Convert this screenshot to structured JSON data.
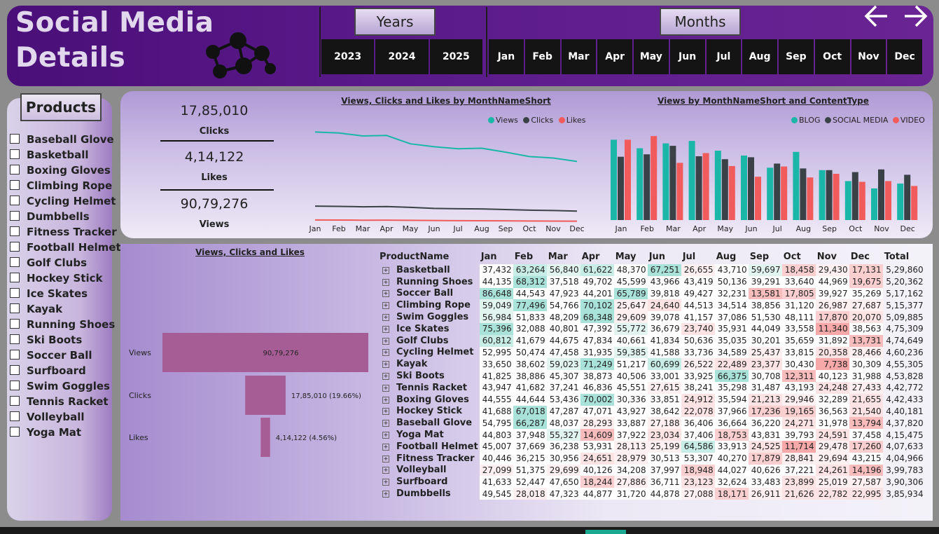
{
  "header": {
    "title": "Social Media Details",
    "years_label": "Years",
    "months_label": "Months"
  },
  "years": [
    "2023",
    "2024",
    "2025"
  ],
  "months": [
    "Jan",
    "Feb",
    "Mar",
    "Apr",
    "May",
    "Jun",
    "Jul",
    "Aug",
    "Sep",
    "Oct",
    "Nov",
    "Dec"
  ],
  "products_label": "Products",
  "products": [
    "Baseball Glove",
    "Basketball",
    "Boxing Gloves",
    "Climbing Rope",
    "Cycling Helmet",
    "Dumbbells",
    "Fitness Tracker",
    "Football Helmet",
    "Golf Clubs",
    "Hockey Stick",
    "Ice Skates",
    "Kayak",
    "Running Shoes",
    "Ski Boots",
    "Soccer Ball",
    "Surfboard",
    "Swim Goggles",
    "Tennis Racket",
    "Volleyball",
    "Yoga Mat"
  ],
  "kpis": [
    {
      "value": "17,85,010",
      "label": "Clicks"
    },
    {
      "value": "4,14,122",
      "label": "Likes"
    },
    {
      "value": "90,79,276",
      "label": "Views"
    }
  ],
  "colors": {
    "views": "#1ab6a8",
    "clicks": "#3a4248",
    "likes": "#f15b5b",
    "funnel": "#a65d96"
  },
  "chart_data": [
    {
      "type": "line",
      "title": "Views, Clicks and Likes by MonthNameShort",
      "categories": [
        "Jan",
        "Feb",
        "Mar",
        "Apr",
        "May",
        "Jun",
        "Jul",
        "Aug",
        "Sep",
        "Oct",
        "Nov",
        "Dec"
      ],
      "series": [
        {
          "name": "Views",
          "values": [
            940000,
            930000,
            900000,
            905000,
            820000,
            790000,
            770000,
            775000,
            735000,
            690000,
            675000,
            640000
          ]
        },
        {
          "name": "Clicks",
          "values": [
            185000,
            182000,
            178000,
            180000,
            172000,
            162000,
            158000,
            156000,
            150000,
            144000,
            140000,
            134000
          ]
        },
        {
          "name": "Likes",
          "values": [
            44000,
            43000,
            41500,
            42000,
            40000,
            38000,
            36500,
            36000,
            34500,
            33000,
            32000,
            31000
          ]
        }
      ],
      "ylim": [
        0,
        1000000
      ]
    },
    {
      "type": "bar",
      "title": "Views by MonthNameShort and ContentType",
      "categories": [
        "Jan",
        "Feb",
        "Mar",
        "Apr",
        "May",
        "Jun",
        "Jul",
        "Aug",
        "Sep",
        "Oct",
        "Nov",
        "Dec"
      ],
      "series": [
        {
          "name": "BLOG",
          "values": [
            330000,
            295000,
            315000,
            325000,
            285000,
            265000,
            215000,
            280000,
            205000,
            160000,
            130000,
            150000
          ]
        },
        {
          "name": "SOCIAL MEDIA",
          "values": [
            260000,
            270000,
            305000,
            262000,
            250000,
            258000,
            232000,
            212000,
            205000,
            197000,
            208000,
            186000
          ]
        },
        {
          "name": "VIDEO",
          "values": [
            330000,
            345000,
            235000,
            275000,
            222000,
            178000,
            220000,
            175000,
            190000,
            157000,
            160000,
            140000
          ]
        }
      ],
      "ylim": [
        0,
        380000
      ]
    },
    {
      "type": "bar",
      "title": "Views, Clicks and Likes",
      "categories": [
        "Views",
        "Clicks",
        "Likes"
      ],
      "values": [
        9079276,
        1785010,
        414122
      ],
      "data_labels": [
        "90,79,276",
        "17,85,010 (19.66%)",
        "4,14,122 (4.56%)"
      ]
    }
  ],
  "matrix": {
    "header": [
      "ProductName",
      "Jan",
      "Feb",
      "Mar",
      "Apr",
      "May",
      "Jun",
      "Jul",
      "Aug",
      "Sep",
      "Oct",
      "Nov",
      "Dec",
      "Total"
    ],
    "rows": [
      {
        "name": "Basketball",
        "values": [
          "37,432",
          "63,264",
          "56,840",
          "61,622",
          "48,370",
          "67,251",
          "26,655",
          "43,710",
          "59,697",
          "18,458",
          "29,430",
          "17,131"
        ],
        "total": "5,29,860"
      },
      {
        "name": "Running Shoes",
        "values": [
          "44,135",
          "68,312",
          "37,518",
          "49,702",
          "45,599",
          "43,966",
          "43,419",
          "50,136",
          "39,291",
          "33,640",
          "44,969",
          "19,675"
        ],
        "total": "5,20,362"
      },
      {
        "name": "Soccer Ball",
        "values": [
          "86,648",
          "44,543",
          "47,923",
          "44,201",
          "65,789",
          "39,818",
          "49,427",
          "32,231",
          "13,581",
          "17,805",
          "39,927",
          "35,269"
        ],
        "total": "5,17,162"
      },
      {
        "name": "Climbing Rope",
        "values": [
          "59,049",
          "77,496",
          "54,766",
          "70,102",
          "25,647",
          "24,640",
          "44,513",
          "34,514",
          "38,856",
          "31,120",
          "26,987",
          "27,687"
        ],
        "total": "5,15,377"
      },
      {
        "name": "Swim Goggles",
        "values": [
          "56,984",
          "51,833",
          "48,209",
          "68,348",
          "29,609",
          "39,078",
          "41,157",
          "37,086",
          "51,530",
          "48,111",
          "17,870",
          "20,070"
        ],
        "total": "5,09,885"
      },
      {
        "name": "Ice Skates",
        "values": [
          "75,396",
          "32,088",
          "40,801",
          "47,392",
          "55,772",
          "36,679",
          "23,740",
          "35,931",
          "44,049",
          "33,558",
          "11,340",
          "38,563"
        ],
        "total": "4,75,309"
      },
      {
        "name": "Golf Clubs",
        "values": [
          "60,812",
          "41,679",
          "44,675",
          "47,834",
          "40,661",
          "41,834",
          "50,636",
          "35,035",
          "30,201",
          "35,659",
          "31,892",
          "13,731"
        ],
        "total": "4,74,649"
      },
      {
        "name": "Cycling Helmet",
        "values": [
          "52,995",
          "50,474",
          "47,458",
          "31,935",
          "59,385",
          "41,588",
          "33,736",
          "34,589",
          "25,437",
          "33,815",
          "20,358",
          "28,466"
        ],
        "total": "4,60,236"
      },
      {
        "name": "Kayak",
        "values": [
          "33,650",
          "38,602",
          "59,023",
          "71,249",
          "51,217",
          "60,699",
          "26,522",
          "22,489",
          "23,377",
          "30,430",
          "7,738",
          "30,309"
        ],
        "total": "4,55,305"
      },
      {
        "name": "Ski Boots",
        "values": [
          "41,825",
          "38,886",
          "45,307",
          "38,873",
          "40,506",
          "33,001",
          "33,925",
          "66,375",
          "30,708",
          "12,311",
          "40,123",
          "31,988"
        ],
        "total": "4,53,828"
      },
      {
        "name": "Tennis Racket",
        "values": [
          "43,947",
          "41,682",
          "37,241",
          "46,836",
          "45,551",
          "27,615",
          "38,241",
          "35,298",
          "31,487",
          "43,193",
          "24,248",
          "27,433"
        ],
        "total": "4,42,772"
      },
      {
        "name": "Boxing Gloves",
        "values": [
          "44,555",
          "44,644",
          "53,436",
          "70,002",
          "30,336",
          "33,851",
          "24,912",
          "35,594",
          "21,213",
          "29,946",
          "32,289",
          "21,655"
        ],
        "total": "4,42,433"
      },
      {
        "name": "Hockey Stick",
        "values": [
          "41,688",
          "67,018",
          "47,287",
          "47,071",
          "43,927",
          "38,642",
          "22,078",
          "37,966",
          "17,236",
          "19,165",
          "36,563",
          "21,540"
        ],
        "total": "4,40,181"
      },
      {
        "name": "Baseball Glove",
        "values": [
          "54,795",
          "66,287",
          "48,037",
          "28,293",
          "33,887",
          "27,188",
          "36,406",
          "36,664",
          "36,220",
          "24,271",
          "31,978",
          "13,794"
        ],
        "total": "4,37,820"
      },
      {
        "name": "Yoga Mat",
        "values": [
          "44,803",
          "37,948",
          "55,327",
          "14,609",
          "37,922",
          "23,034",
          "37,406",
          "18,753",
          "43,831",
          "39,793",
          "24,591",
          "37,458"
        ],
        "total": "4,15,475"
      },
      {
        "name": "Football Helmet",
        "values": [
          "45,007",
          "37,669",
          "36,238",
          "53,931",
          "28,113",
          "25,199",
          "64,586",
          "33,913",
          "24,525",
          "11,714",
          "29,478",
          "17,260"
        ],
        "total": "4,07,633"
      },
      {
        "name": "Fitness Tracker",
        "values": [
          "40,446",
          "36,215",
          "30,956",
          "24,651",
          "28,979",
          "30,513",
          "53,307",
          "40,270",
          "17,879",
          "28,841",
          "29,694",
          "43,215"
        ],
        "total": "4,04,966"
      },
      {
        "name": "Volleyball",
        "values": [
          "27,099",
          "51,375",
          "29,699",
          "40,126",
          "34,208",
          "37,997",
          "18,948",
          "44,027",
          "40,626",
          "37,221",
          "24,261",
          "14,196"
        ],
        "total": "3,99,783"
      },
      {
        "name": "Surfboard",
        "values": [
          "41,633",
          "52,447",
          "47,650",
          "18,244",
          "27,886",
          "36,711",
          "23,123",
          "32,624",
          "33,483",
          "23,899",
          "25,019",
          "27,587"
        ],
        "total": "3,90,306"
      },
      {
        "name": "Dumbbells",
        "values": [
          "49,545",
          "28,018",
          "47,323",
          "44,877",
          "31,720",
          "44,878",
          "27,088",
          "18,171",
          "26,911",
          "21,626",
          "22,782",
          "22,995"
        ],
        "total": "3,85,934"
      }
    ]
  }
}
